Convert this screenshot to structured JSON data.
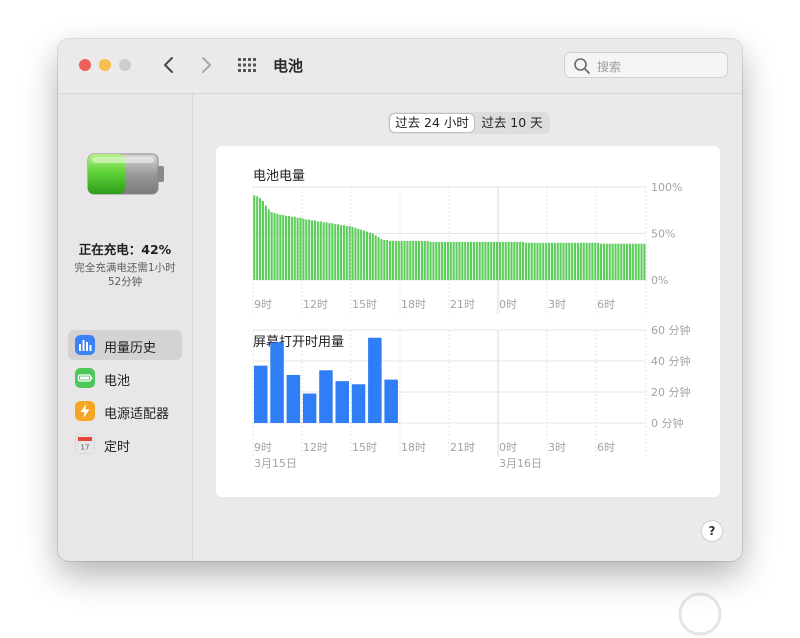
{
  "window": {
    "title": "电池"
  },
  "toolbar": {
    "search_placeholder": "搜索",
    "back_icon": "chevron-left-icon",
    "forward_icon": "chevron-right-icon",
    "grid_icon": "grid-icon"
  },
  "sidebar": {
    "status_main": "正在充电：42%",
    "status_line1": "完全充满电还需1小时",
    "status_line2": "52分钟",
    "battery_level": 0.42,
    "items": [
      {
        "label": "用量历史",
        "icon": "bar-chart-icon",
        "color": "#3b82f6",
        "selected": true
      },
      {
        "label": "电池",
        "icon": "battery-icon",
        "color": "#4cc759",
        "selected": false
      },
      {
        "label": "电源适配器",
        "icon": "lightning-icon",
        "color": "#f5a623",
        "selected": false
      },
      {
        "label": "定时",
        "icon": "calendar-icon",
        "color": "#e5e5e5",
        "selected": false
      }
    ]
  },
  "segments": [
    {
      "label": "过去 24 小时",
      "active": true
    },
    {
      "label": "过去 10 天",
      "active": false
    }
  ],
  "help_label": "?",
  "colors": {
    "battery_green": "#5ccc5a",
    "screen_blue": "#2f7ef5"
  },
  "chart_data": [
    {
      "type": "bar",
      "title": "电池电量",
      "y_ticks": [
        "100%",
        "50%",
        "0%"
      ],
      "ylim": [
        0,
        100
      ],
      "x_ticks": [
        "9时",
        "12时",
        "15时",
        "18时",
        "21时",
        "0时",
        "3时",
        "6时"
      ],
      "grid": true,
      "values": [
        91,
        90,
        88,
        85,
        80,
        76,
        73,
        72,
        71,
        70,
        70,
        69,
        69,
        68,
        68,
        67,
        67,
        66,
        65,
        65,
        64,
        64,
        63,
        63,
        62,
        62,
        61,
        61,
        60,
        60,
        59,
        59,
        58,
        58,
        57,
        56,
        55,
        54,
        53,
        52,
        51,
        50,
        48,
        46,
        44,
        43,
        43,
        42,
        42,
        42,
        42,
        42,
        42,
        42,
        42,
        42,
        42,
        42,
        42,
        42,
        42,
        41,
        41,
        41,
        41,
        41,
        41,
        41,
        41,
        41,
        41,
        41,
        41,
        41,
        41,
        41,
        41,
        41,
        41,
        41,
        41,
        41,
        41,
        41,
        41,
        41,
        41,
        41,
        41,
        41,
        41,
        41,
        41,
        41,
        40,
        40,
        40,
        40,
        40,
        40,
        40,
        40,
        40,
        40,
        40,
        40,
        40,
        40,
        40,
        40,
        40,
        40,
        40,
        40,
        40,
        40,
        40,
        40,
        40,
        40,
        39,
        39,
        39,
        39,
        39,
        39,
        39,
        39,
        39,
        39,
        39,
        39,
        39,
        39,
        39,
        39
      ]
    },
    {
      "type": "bar",
      "title": "屏幕打开时用量",
      "y_ticks": [
        "60 分钟",
        "40 分钟",
        "20 分钟",
        "0 分钟"
      ],
      "ylim": [
        0,
        60
      ],
      "x_ticks": [
        "9时",
        "12时",
        "15时",
        "18时",
        "21时",
        "0时",
        "3时",
        "6时"
      ],
      "date_labels": [
        "3月15日",
        "3月16日"
      ],
      "grid": true,
      "values": [
        37,
        52,
        31,
        19,
        34,
        27,
        25,
        55,
        28
      ]
    }
  ]
}
